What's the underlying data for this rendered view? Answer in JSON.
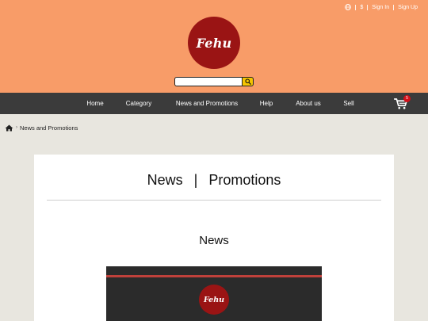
{
  "topbar": {
    "language_icon": "globe-icon",
    "currency": "$",
    "sign_in": "Sign In",
    "sign_up": "Sign Up"
  },
  "brand": {
    "logo_text": "Fehu",
    "color": "#9a1414"
  },
  "search": {
    "placeholder": "",
    "icon": "search-icon"
  },
  "nav": {
    "items": [
      "Home",
      "Category",
      "News and Promotions",
      "Help",
      "About us",
      "Sell"
    ],
    "cart_count": "5"
  },
  "breadcrumb": {
    "home_icon": "home-icon",
    "current": "News and Promotions"
  },
  "main": {
    "tabs": [
      "News",
      "Promotions"
    ],
    "divider": "|",
    "section_title": "News",
    "banner_logo": "Fehu"
  },
  "colors": {
    "header": "#f89c68",
    "nav": "#3b3b3b",
    "accent": "#c0413b",
    "search_button": "#f5c400",
    "page_bg": "#e8e6df"
  }
}
